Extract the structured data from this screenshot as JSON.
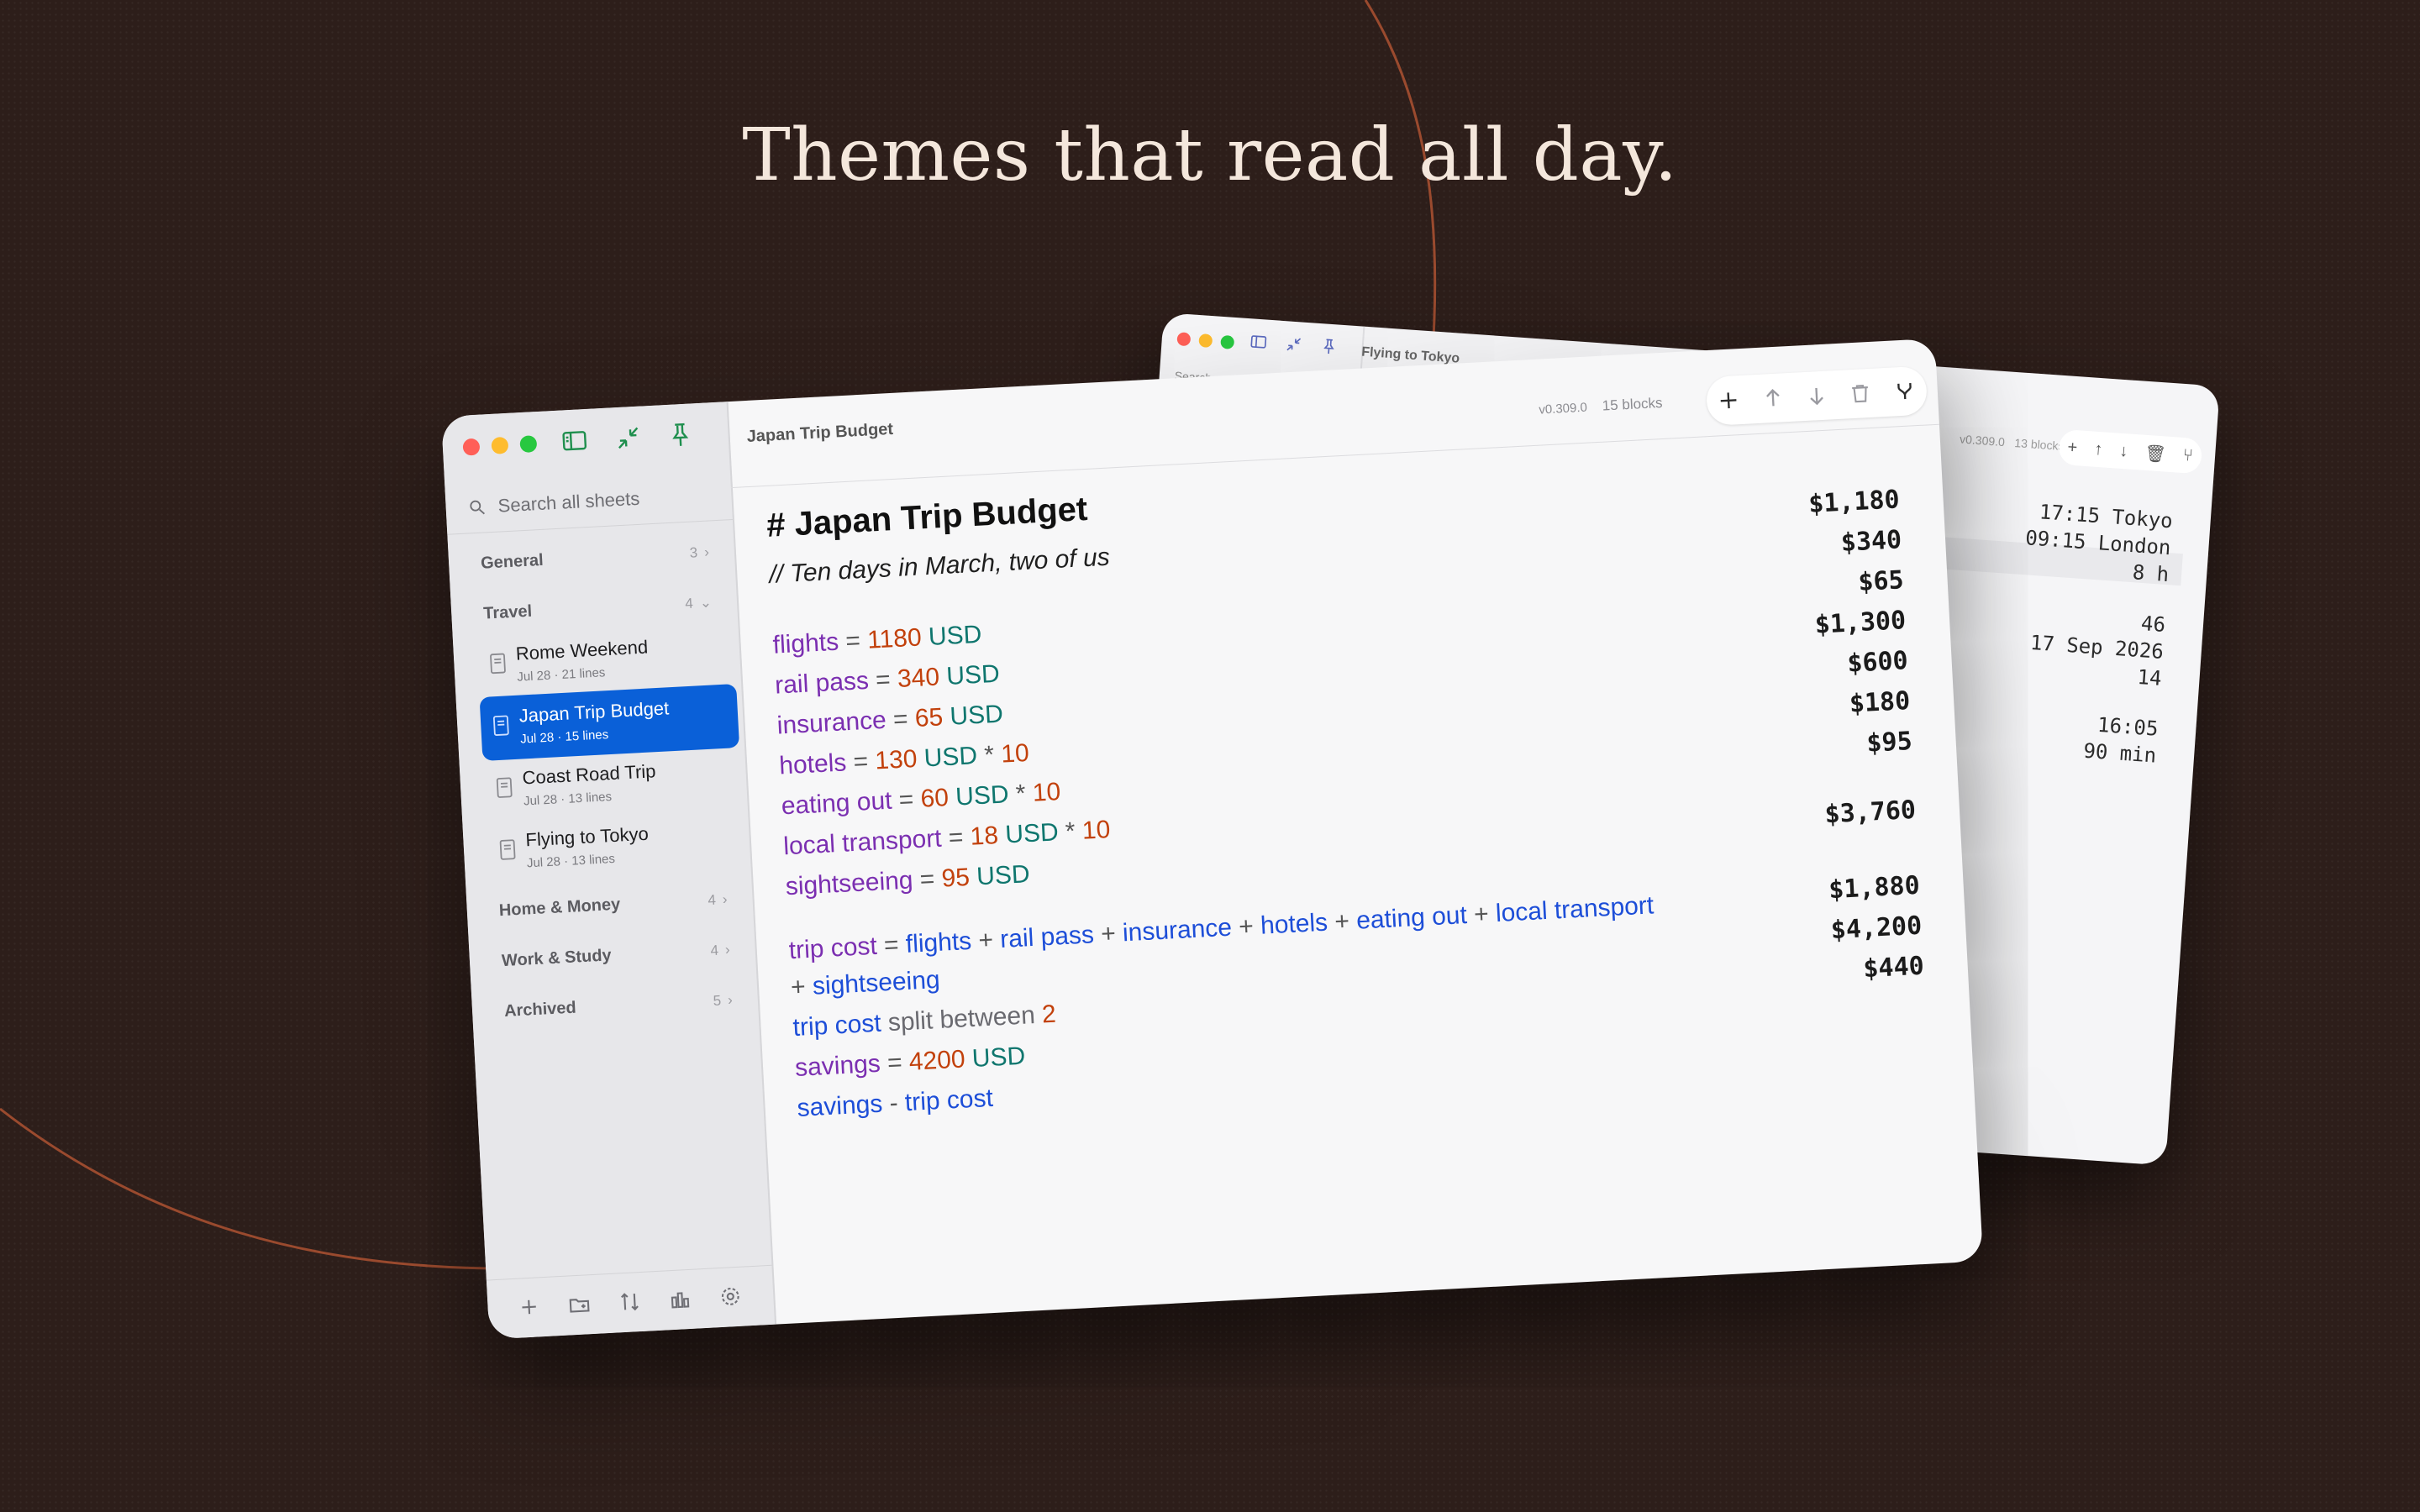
{
  "headline": "Themes that read all day.",
  "back_window": {
    "title": "Flying to Tokyo",
    "search_placeholder": "Search",
    "version": "v0.309.0",
    "blocks": "13 blocks",
    "results": [
      "17:15 Tokyo",
      "09:15 London",
      "8 h",
      "46",
      "17 Sep 2026",
      "14",
      "16:05",
      "90 min"
    ]
  },
  "front_window": {
    "title": "Japan Trip Budget",
    "version": "v0.309.0",
    "blocks": "15 blocks",
    "sidebar": {
      "search_placeholder": "Search all sheets",
      "groups": [
        {
          "name": "General",
          "count": "3"
        },
        {
          "name": "Travel",
          "count": "4"
        },
        {
          "name": "Home & Money",
          "count": "4"
        },
        {
          "name": "Work & Study",
          "count": "4"
        },
        {
          "name": "Archived",
          "count": "5"
        }
      ],
      "items": [
        {
          "name": "Rome Weekend",
          "meta": "Jul 28 · 21 lines"
        },
        {
          "name": "Japan Trip Budget",
          "meta": "Jul 28 · 15 lines"
        },
        {
          "name": "Coast Road Trip",
          "meta": "Jul 28 · 13 lines"
        },
        {
          "name": "Flying to Tokyo",
          "meta": "Jul 28 · 13 lines"
        }
      ]
    },
    "editor": {
      "heading": "# Japan Trip Budget",
      "comment": "// Ten days in March, two of us",
      "lines": {
        "flights": {
          "var": "flights",
          "eq": " = ",
          "num": "1180",
          "unit": " USD"
        },
        "rail": {
          "var": "rail pass",
          "eq": " = ",
          "num": "340",
          "unit": " USD"
        },
        "insurance": {
          "var": "insurance",
          "eq": " = ",
          "num": "65",
          "unit": " USD"
        },
        "hotels": {
          "var": "hotels",
          "eq": " = ",
          "num": "130",
          "unit": " USD",
          "op": " * ",
          "mult": "10"
        },
        "eating": {
          "var": "eating out",
          "eq": " = ",
          "num": "60",
          "unit": " USD",
          "op": " * ",
          "mult": "10"
        },
        "transport": {
          "var": "local transport",
          "eq": " = ",
          "num": "18",
          "unit": " USD",
          "op": " * ",
          "mult": "10"
        },
        "sight": {
          "var": "sightseeing",
          "eq": " = ",
          "num": "95",
          "unit": " USD"
        },
        "trip_a": {
          "var": "trip cost",
          "eq": " = ",
          "r1": "flights",
          "r2": "rail pass",
          "r3": "insurance",
          "r4": "hotels",
          "r5": "eating out",
          "r6": "local transport",
          "plus": " + "
        },
        "trip_b": {
          "plus": "+ ",
          "r7": "sightseeing"
        },
        "split": {
          "ref": "trip cost",
          "kw": " split between ",
          "num": "2"
        },
        "savings": {
          "var": "savings",
          "eq": " = ",
          "num": "4200",
          "unit": " USD"
        },
        "diff": {
          "r1": "savings",
          "op": " - ",
          "r2": "trip cost"
        }
      },
      "results": [
        "$1,180",
        "$340",
        "$65",
        "$1,300",
        "$600",
        "$180",
        "$95",
        "$3,760",
        "$1,880",
        "$4,200",
        "$440"
      ]
    }
  },
  "colors": {
    "background": "#2d1e1a",
    "accent": "#0a60d8",
    "variable": "#7b2fb1",
    "number": "#c2410c",
    "unit": "#0f766e",
    "reference": "#1d4ed8"
  }
}
